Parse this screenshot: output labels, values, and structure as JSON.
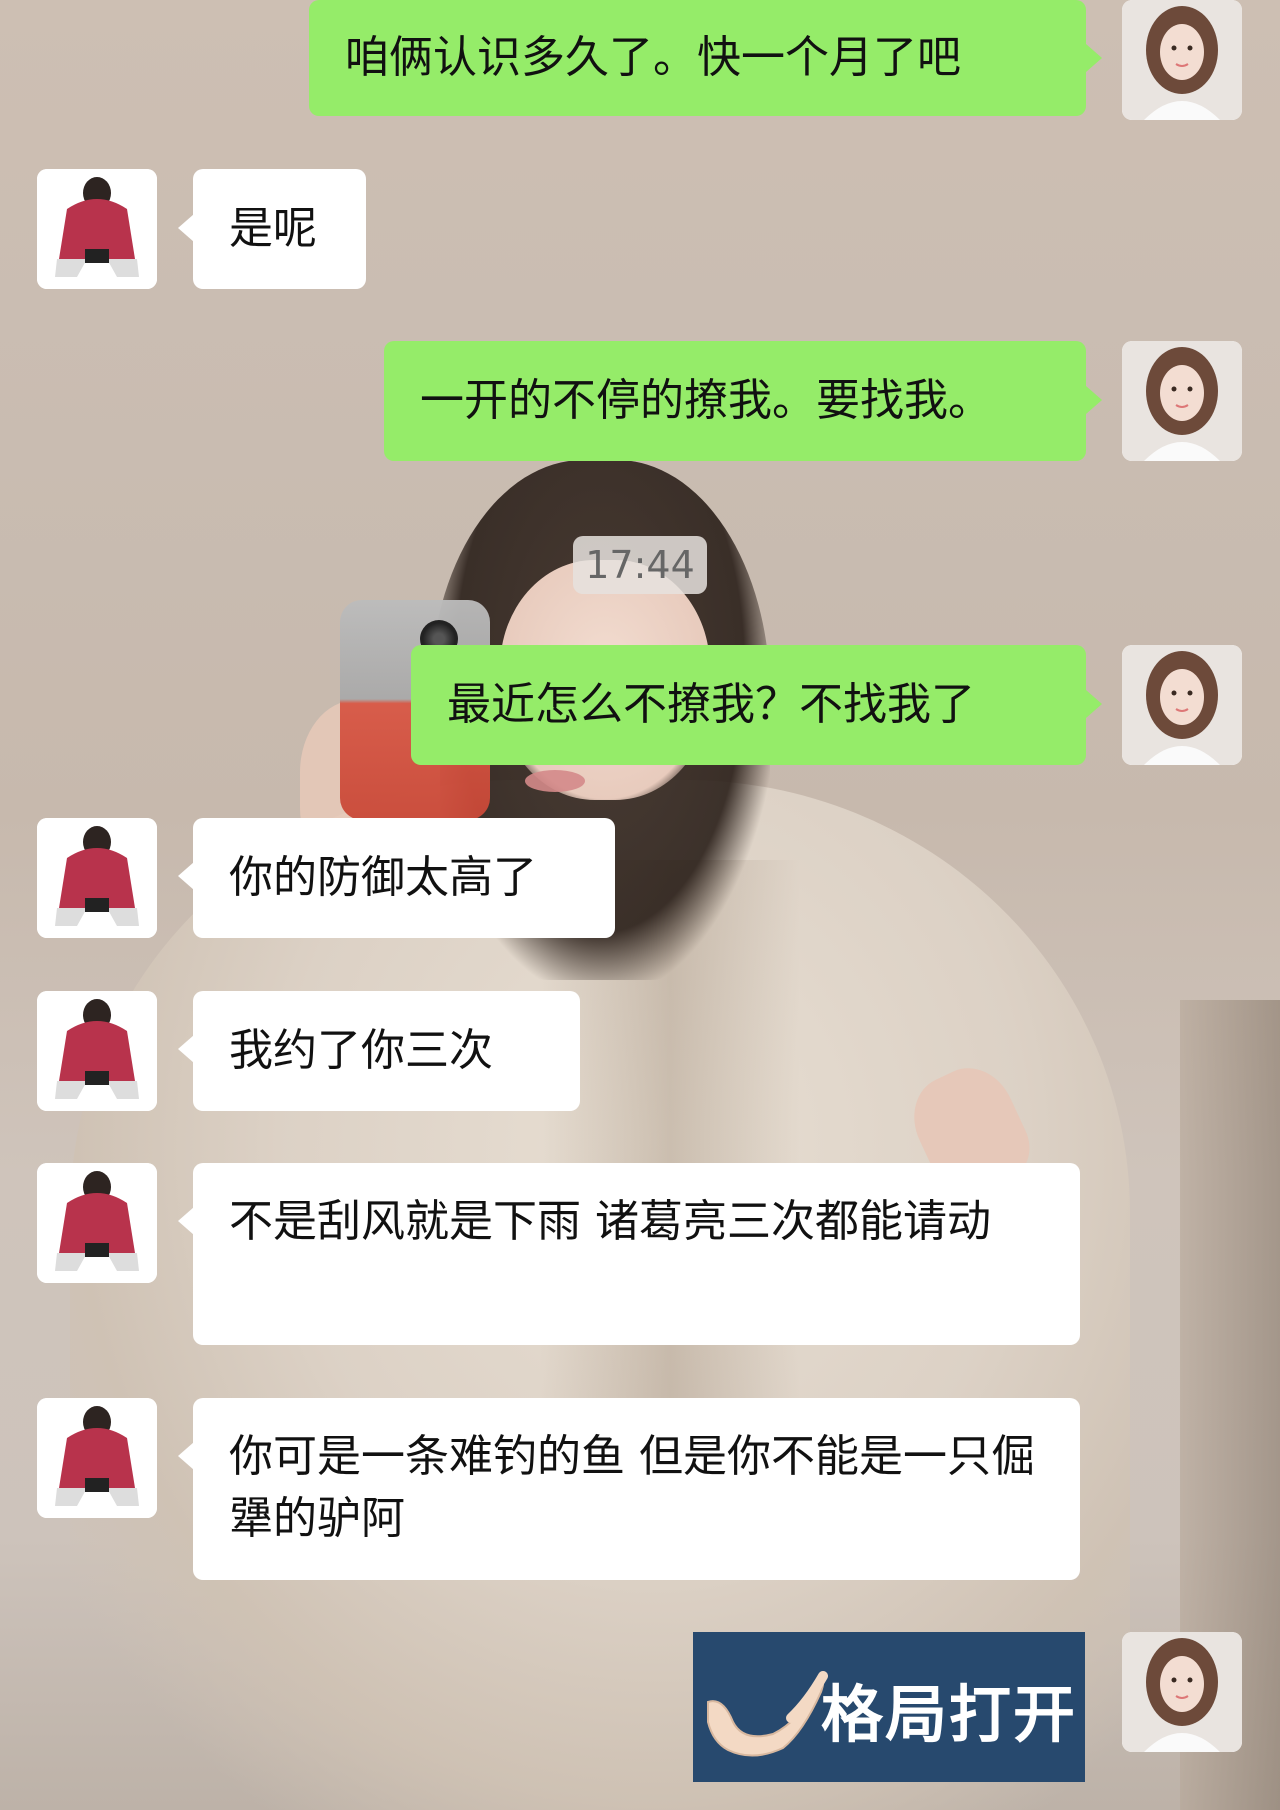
{
  "timestamp": "17:44",
  "avatars": {
    "me": "woman-selfie-avatar",
    "other": "crouching-hoodie-avatar"
  },
  "colors": {
    "me_bubble": "#95ec69",
    "other_bubble": "#ffffff",
    "sticker_bg": "#27496e"
  },
  "messages": [
    {
      "sender": "me",
      "text": "咱俩认识多久了。快一个月了吧"
    },
    {
      "sender": "other",
      "text": "是呢"
    },
    {
      "sender": "me",
      "text": "一开的不停的撩我。要找我。"
    },
    {
      "sender": "me",
      "text": "最近怎么不撩我？不找我了"
    },
    {
      "sender": "other",
      "text": "你的防御太高了"
    },
    {
      "sender": "other",
      "text": "我约了你三次"
    },
    {
      "sender": "other",
      "text": "不是刮风就是下雨 诸葛亮三次都能请动"
    },
    {
      "sender": "other",
      "text": "你可是一条难钓的鱼 但是你不能是一只倔犟的驴阿"
    }
  ],
  "sticker": {
    "icon": "open-hand-icon",
    "text": "格局打开"
  }
}
